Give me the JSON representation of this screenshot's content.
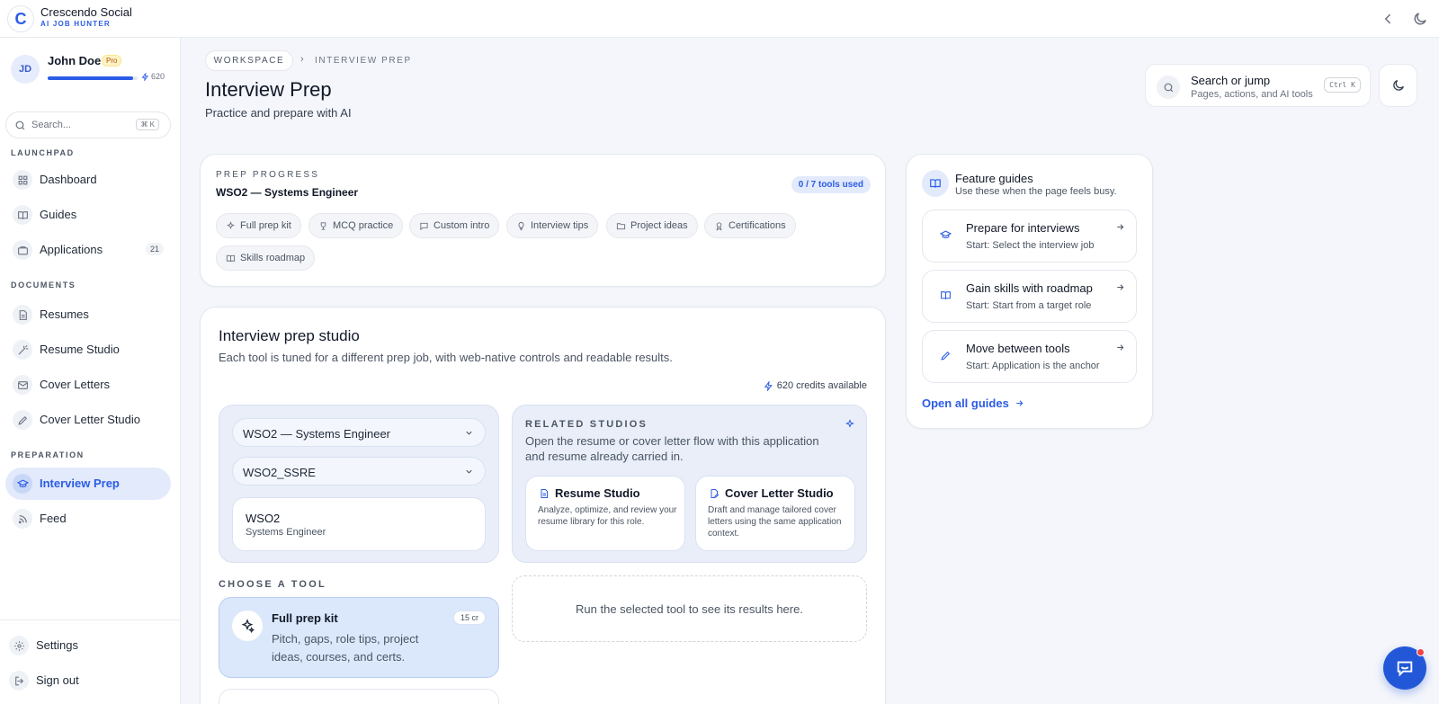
{
  "app": {
    "name": "Crescendo Social",
    "tagline": "AI JOB HUNTER",
    "logo_letter": "C"
  },
  "user": {
    "initials": "JD",
    "name": "John Doe",
    "plan": "Pro",
    "credits": "620",
    "credit_fraction": 0.95
  },
  "sidebar": {
    "search_placeholder": "Search...",
    "search_shortcut": "⌘ K",
    "sections": {
      "launchpad": "LAUNCHPAD",
      "documents": "DOCUMENTS",
      "preparation": "PREPARATION"
    },
    "items": [
      {
        "label": "Dashboard",
        "icon": "grid-icon"
      },
      {
        "label": "Guides",
        "icon": "book-icon"
      },
      {
        "label": "Applications",
        "icon": "briefcase-icon",
        "count": "21"
      },
      {
        "label": "Resumes",
        "icon": "file-icon"
      },
      {
        "label": "Resume Studio",
        "icon": "wand-icon"
      },
      {
        "label": "Cover Letters",
        "icon": "mail-icon"
      },
      {
        "label": "Cover Letter Studio",
        "icon": "pen-icon"
      },
      {
        "label": "Interview Prep",
        "icon": "graduation-cap-icon",
        "active": true
      },
      {
        "label": "Feed",
        "icon": "rss-icon"
      }
    ],
    "settings": "Settings",
    "signout": "Sign out"
  },
  "header": {
    "breadcrumb_root": "WORKSPACE",
    "breadcrumb_current": "INTERVIEW PREP",
    "title": "Interview Prep",
    "subtitle": "Practice and prepare with AI",
    "search_title": "Search or jump",
    "search_hint": "Pages, actions, and AI tools",
    "search_shortcut": "Ctrl K"
  },
  "progress": {
    "label": "PREP PROGRESS",
    "job": "WSO2 — Systems Engineer",
    "badge": "0 / 7 tools used",
    "chips": [
      "Full prep kit",
      "MCQ practice",
      "Custom intro",
      "Interview tips",
      "Project ideas",
      "Certifications",
      "Skills roadmap"
    ]
  },
  "studio": {
    "title": "Interview prep studio",
    "subtitle": "Each tool is tuned for a different prep job, with web-native controls and readable results.",
    "credits": "620 credits available",
    "job_select": "WSO2 — Systems Engineer",
    "resume_select": "WSO2_SSRE",
    "job_company": "WSO2",
    "job_role": "Systems Engineer",
    "related_label": "RELATED STUDIOS",
    "related_desc": "Open the resume or cover letter flow with this application and resume already carried in.",
    "related": [
      {
        "title": "Resume Studio",
        "desc": "Analyze, optimize, and review your resume library for this role."
      },
      {
        "title": "Cover Letter Studio",
        "desc": "Draft and manage tailored cover letters using the same application context."
      }
    ],
    "choose_label": "CHOOSE A TOOL",
    "tool": {
      "title": "Full prep kit",
      "desc": "Pitch, gaps, role tips, project ideas, courses, and certs.",
      "cost": "15 cr"
    },
    "results_placeholder": "Run the selected tool to see its results here."
  },
  "guides": {
    "title": "Feature guides",
    "subtitle": "Use these when the page feels busy.",
    "items": [
      {
        "title": "Prepare for interviews",
        "start": "Start: Select the interview job"
      },
      {
        "title": "Gain skills with roadmap",
        "start": "Start: Start from a target role"
      },
      {
        "title": "Move between tools",
        "start": "Start: Application is the anchor"
      }
    ],
    "open_all": "Open all guides"
  },
  "colors": {
    "accent": "#2b5ce6",
    "fab": "#2258d8",
    "notification": "#ef4444"
  }
}
